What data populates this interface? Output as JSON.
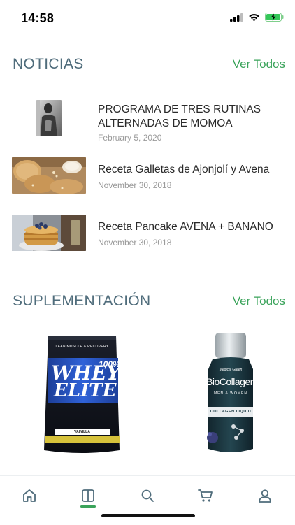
{
  "status": {
    "time": "14:58"
  },
  "news": {
    "title": "NOTICIAS",
    "see_all": "Ver Todos",
    "items": [
      {
        "title": "PROGRAMA DE TRES RUTINAS ALTERNADAS DE MOMOA",
        "date": "February 5, 2020"
      },
      {
        "title": "Receta Galletas de Ajonjolí y Avena",
        "date": "November 30, 2018"
      },
      {
        "title": "Receta Pancake AVENA + BANANO",
        "date": "November 30, 2018"
      }
    ]
  },
  "supplements": {
    "title": "SUPLEMENTACIÓN",
    "see_all": "Ver Todos",
    "products": [
      {
        "brand": "LEAN MUSCLE & RECOVERY",
        "name_line1": "100%",
        "name_line2": "WHEY",
        "name_line3": "ELITE",
        "flavor": "VAINILLA"
      },
      {
        "brand": "Medical Green",
        "name": "BioCollagen",
        "tagline": "MEN & WOMEN",
        "sub": "COLLAGEN LIQUID"
      }
    ]
  },
  "tabbar": {
    "icons": [
      "home-icon",
      "book-icon",
      "search-icon",
      "cart-icon",
      "user-icon"
    ],
    "active_index": 1,
    "accent": "#3aa35a"
  }
}
